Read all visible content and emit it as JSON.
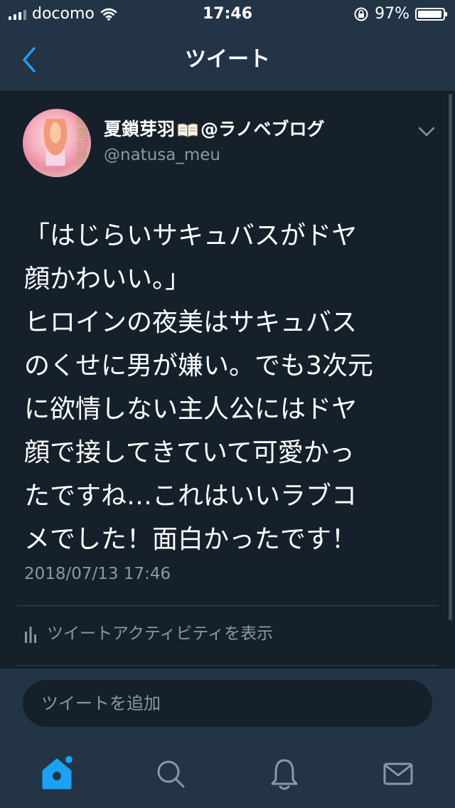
{
  "status_bar": {
    "carrier": "docomo",
    "time": "17:46",
    "battery": "97%",
    "battery_level": 0.97
  },
  "nav": {
    "title": "ツイート"
  },
  "tweet": {
    "author_name_before": "夏鎖芽羽",
    "author_name_after": "@ラノベブログ",
    "avatar_text": "精霊幻想学",
    "handle": "@natusa_meu",
    "text": "「はじらいサキュバスがドヤ\n顔かわいい。」\nヒロインの夜美はサキュバス\nのくせに男が嫌い。でも3次元\nに欲情しない主人公にはドヤ\n顔で接してきていて可愛かっ\nたですね…これはいいラブコ\nメでした！面白かったです！",
    "timestamp": "2018/07/13 17:46",
    "activity_label": "ツイートアクティビティを表示"
  },
  "reply": {
    "placeholder": "ツイートを追加"
  },
  "colors": {
    "background": "#15202b",
    "bar": "#243447",
    "accent": "#1da1f2",
    "secondary_text": "#8899a6"
  },
  "tabs": [
    {
      "name": "home-icon",
      "active": true
    },
    {
      "name": "search-icon",
      "active": false
    },
    {
      "name": "notifications-icon",
      "active": false
    },
    {
      "name": "messages-icon",
      "active": false
    }
  ]
}
